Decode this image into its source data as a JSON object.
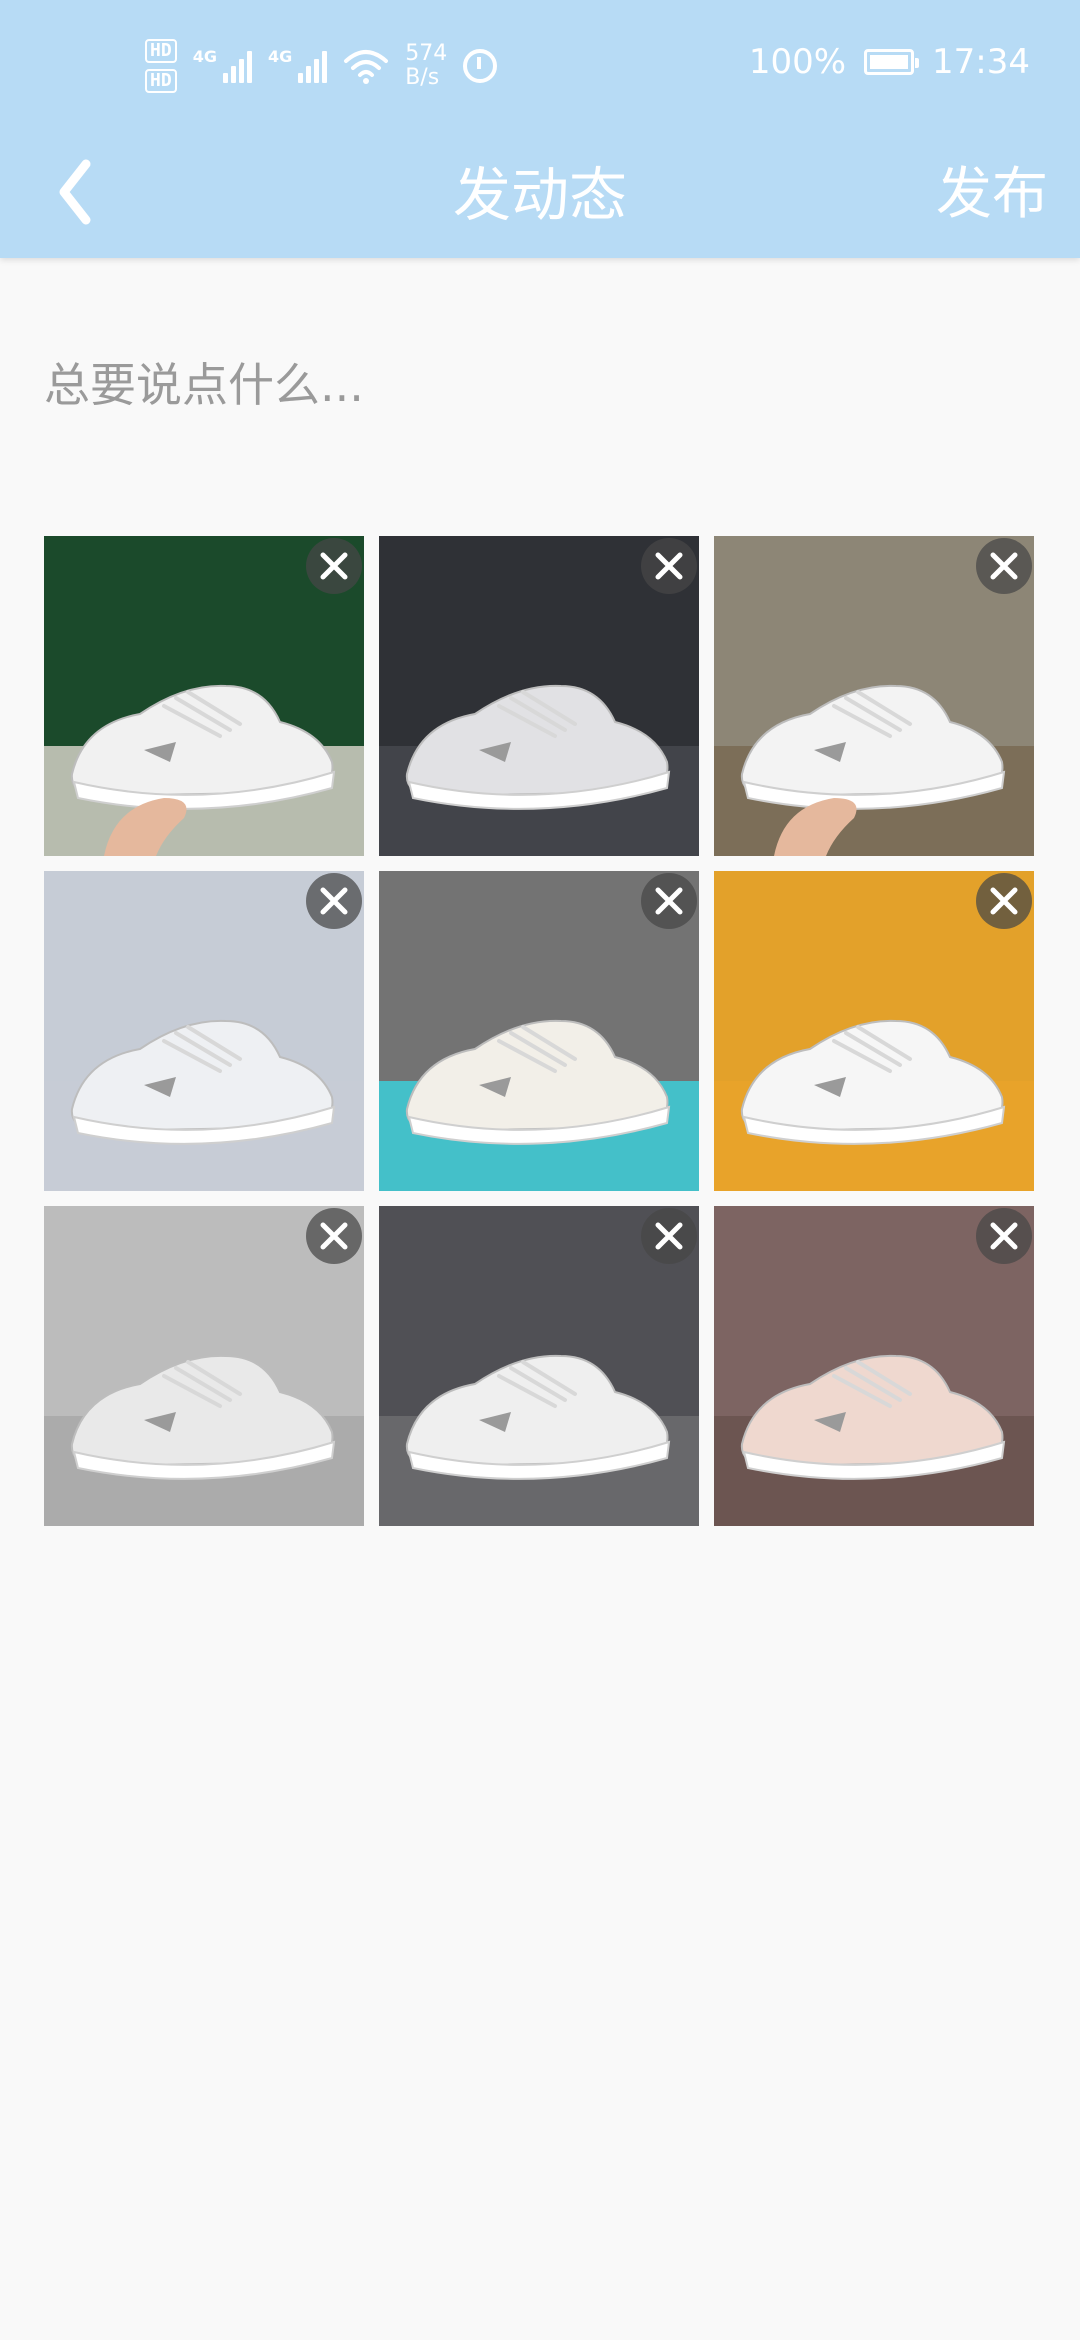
{
  "status_bar": {
    "network": "4G",
    "speed_value": "574",
    "speed_unit": "B/s",
    "battery": "100%",
    "time": "17:34"
  },
  "nav": {
    "title": "发动态",
    "publish_label": "发布"
  },
  "editor": {
    "placeholder": "总要说点什么..."
  },
  "photos": [
    {
      "bg": "#1b4a2b",
      "floor": "#c9c9bd",
      "shoe": "#f1f1f1",
      "hand": true
    },
    {
      "bg": "#2f3136",
      "floor": "#45474d",
      "shoe": "#e1e1e4",
      "hand": false
    },
    {
      "bg": "#8d8676",
      "floor": "#7a6c55",
      "shoe": "#f3f3f3",
      "hand": true
    },
    {
      "bg": "#c6ccd6",
      "floor": "#c6ccd6",
      "shoe": "#eef0f3",
      "hand": false
    },
    {
      "bg": "#737373",
      "floor": "#3fc9d3",
      "shoe": "#f2efe8",
      "hand": false
    },
    {
      "bg": "#e3a12a",
      "floor": "#e8a32a",
      "shoe": "#f6f6f6",
      "hand": false
    },
    {
      "bg": "#bcbcbc",
      "floor": "#a8a8a8",
      "shoe": "#e9e9e9",
      "hand": false
    },
    {
      "bg": "#505055",
      "floor": "#6a6a6e",
      "shoe": "#efefef",
      "hand": false
    },
    {
      "bg": "#7d6462",
      "floor": "#6a5350",
      "shoe": "#efd8cf",
      "hand": false
    }
  ],
  "colors": {
    "header_bg": "#b7dbf5",
    "page_bg": "#f9f9f9",
    "placeholder": "#9a9a9a"
  }
}
